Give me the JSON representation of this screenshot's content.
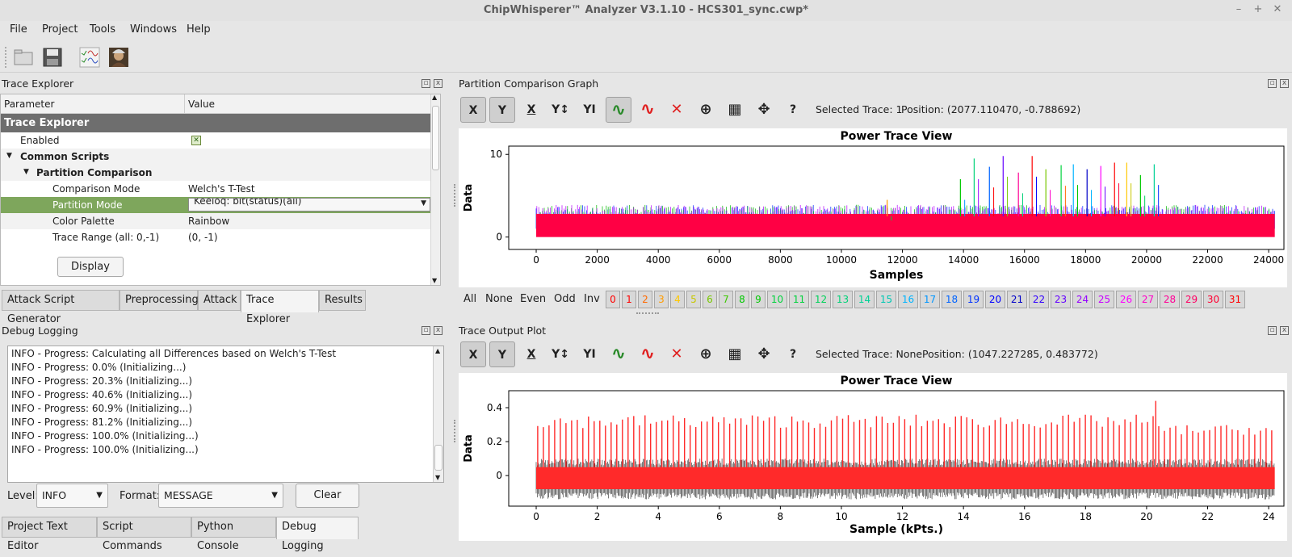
{
  "window": {
    "title": "ChipWhisperer™ Analyzer V3.1.10 - HCS301_sync.cwp*",
    "controls": [
      "–",
      "+",
      "✕"
    ]
  },
  "menu": [
    "File",
    "Project",
    "Tools",
    "Windows",
    "Help"
  ],
  "trace_explorer": {
    "title": "Trace Explorer",
    "columns": [
      "Parameter",
      "Value"
    ],
    "group_header": "Trace Explorer",
    "enabled_label": "Enabled",
    "common_scripts": "Common Scripts",
    "partition_comparison": "Partition Comparison",
    "comparison_mode_label": "Comparison Mode",
    "comparison_mode_value": "Welch's T-Test",
    "partition_mode_label": "Partition Mode",
    "partition_mode_value": "Keeloq: bit(status)(all)",
    "color_palette_label": "Color Palette",
    "color_palette_value": "Rainbow",
    "trace_range_label": "Trace Range (all: 0,-1)",
    "trace_range_value": "(0, -1)",
    "display_button": "Display"
  },
  "top_tabs": [
    "Attack Script Generator",
    "Preprocessing",
    "Attack",
    "Trace Explorer",
    "Results"
  ],
  "debug": {
    "title": "Debug Logging",
    "lines": [
      "INFO - Progress: Calculating all Differences based on Welch's T-Test",
      "INFO - Progress: 0.0% (Initializing...)",
      "INFO - Progress: 20.3% (Initializing...)",
      "INFO - Progress: 40.6% (Initializing...)",
      "INFO - Progress: 60.9% (Initializing...)",
      "INFO - Progress: 81.2% (Initializing...)",
      "INFO - Progress: 100.0% (Initializing...)",
      "INFO - Progress: 100.0% (Initializing...)"
    ],
    "level_label": "Level:",
    "level_value": "INFO",
    "format_label": "Format:",
    "format_value": "MESSAGE",
    "clear_button": "Clear"
  },
  "bottom_tabs": [
    "Project Text Editor",
    "Script Commands",
    "Python Console",
    "Debug Logging"
  ],
  "partition_graph": {
    "title": "Partition Comparison Graph",
    "selected_trace": "Selected Trace: 1",
    "position": "Position: (2077.110470, -0.788692)",
    "toolbar_icons": [
      "X",
      "Y",
      "X",
      "Y↕",
      "YI",
      "∿",
      "∿",
      "✕",
      "⊕",
      "▦",
      "✥",
      "?"
    ],
    "selectors": [
      "All",
      "None",
      "Even",
      "Odd",
      "Inv"
    ],
    "trace_numbers": [
      "0",
      "1",
      "2",
      "3",
      "4",
      "5",
      "6",
      "7",
      "8",
      "9",
      "10",
      "11",
      "12",
      "13",
      "14",
      "15",
      "16",
      "17",
      "18",
      "19",
      "20",
      "21",
      "22",
      "23",
      "24",
      "25",
      "26",
      "27",
      "28",
      "29",
      "30",
      "31"
    ],
    "trace_colors": [
      "#ff0000",
      "#ff0000",
      "#ff6a00",
      "#ff9c00",
      "#ffc800",
      "#c8c800",
      "#78c800",
      "#3cc800",
      "#00c800",
      "#00c800",
      "#00d23c",
      "#00d23c",
      "#00d25a",
      "#00d278",
      "#00d296",
      "#00c8b4",
      "#00b4ff",
      "#0096ff",
      "#0064ff",
      "#0032ff",
      "#0000ff",
      "#0000c8",
      "#3200ff",
      "#6400ff",
      "#9600ff",
      "#c800ff",
      "#ff00ff",
      "#ff00c8",
      "#ff0096",
      "#ff0064",
      "#ff0032",
      "#ff0000"
    ]
  },
  "trace_output": {
    "title": "Trace Output Plot",
    "selected_trace": "Selected Trace: None",
    "position": "Position: (1047.227285, 0.483772)"
  },
  "chart_data": [
    {
      "type": "line",
      "title": "Power Trace View",
      "xlabel": "Samples",
      "ylabel": "Data",
      "xlim": [
        -900,
        24500
      ],
      "ylim": [
        -1.5,
        11
      ],
      "xticks": [
        "0",
        "2000",
        "4000",
        "6000",
        "8000",
        "10000",
        "12000",
        "14000",
        "16000",
        "18000",
        "20000",
        "22000",
        "24000"
      ],
      "yticks": [
        "0",
        "10"
      ],
      "series": [
        {
          "color": "#ff0044",
          "values_band": [
            0,
            2.8
          ]
        },
        {
          "values_peaks_x": [
            11500,
            13900,
            14350,
            14850,
            15300,
            15800,
            16250,
            16700,
            17200,
            17600,
            18050,
            18500,
            18950,
            19350,
            19800,
            20250
          ],
          "values_peaks_y": [
            4.5,
            7.0,
            9.5,
            8.5,
            9.8,
            7.8,
            9.8,
            8.2,
            8.7,
            8.8,
            8.2,
            8.6,
            9.0,
            9.0,
            7.5,
            8.8
          ]
        }
      ]
    },
    {
      "type": "line",
      "title": "Power Trace View",
      "xlabel": "Sample (kPts.)",
      "ylabel": "Data",
      "xlim": [
        -0.9,
        24.5
      ],
      "ylim": [
        -0.18,
        0.5
      ],
      "xticks": [
        "0",
        "2",
        "4",
        "6",
        "8",
        "10",
        "12",
        "14",
        "16",
        "18",
        "20",
        "22",
        "24"
      ],
      "yticks": [
        "0",
        "0.2",
        "0.4"
      ],
      "series": [
        {
          "color": "#ff2a2a",
          "values_band": [
            -0.08,
            0.05
          ],
          "peak_max": 0.44
        }
      ]
    }
  ]
}
